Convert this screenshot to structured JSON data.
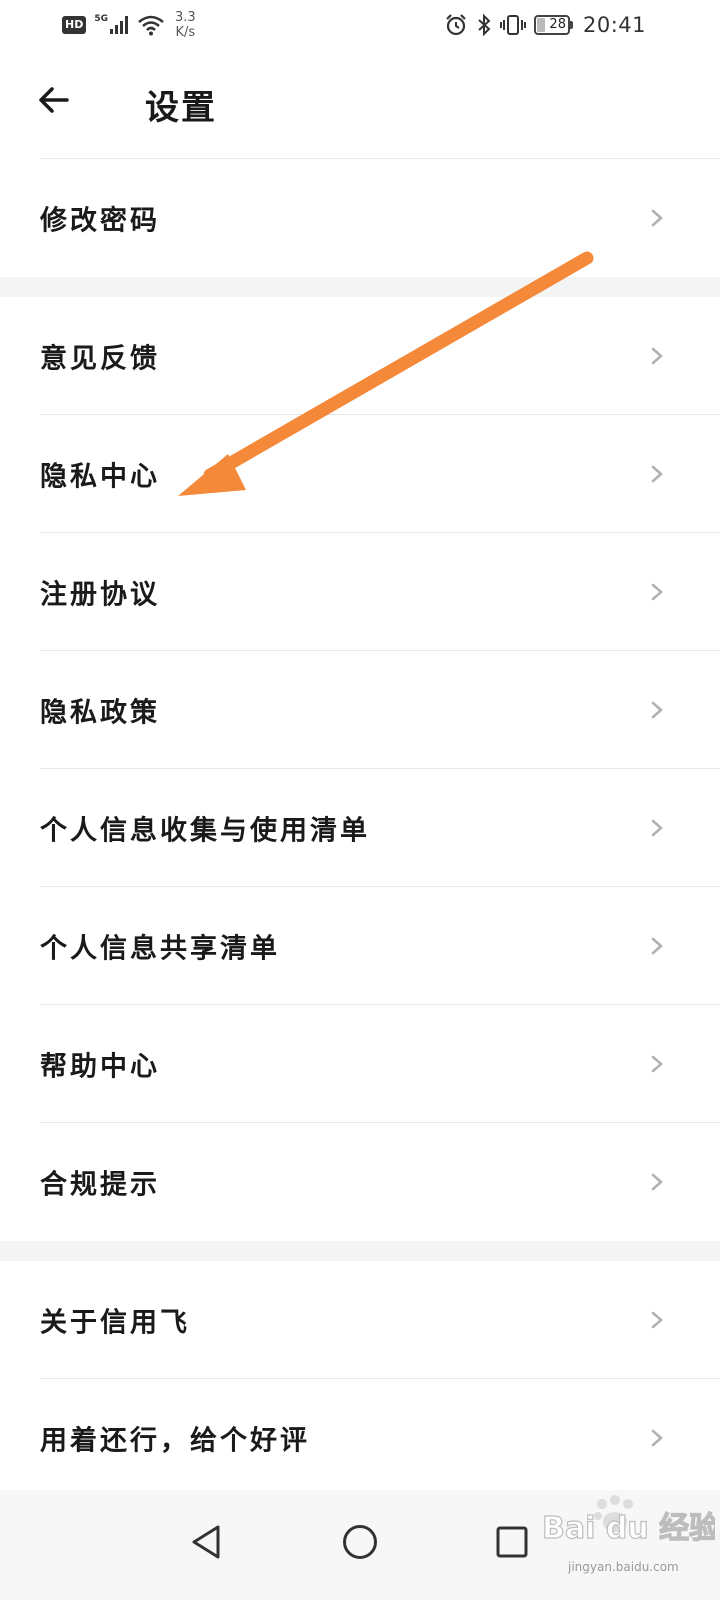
{
  "status_bar": {
    "hd": "HD",
    "network": "5G",
    "speed_value": "3.3",
    "speed_unit": "K/s",
    "battery_level": "28",
    "time": "20:41",
    "icons": [
      "signal-icon",
      "wifi-icon",
      "alarm-icon",
      "bluetooth-icon",
      "vibrate-icon",
      "battery-icon"
    ]
  },
  "header": {
    "title": "设置",
    "back_icon": "arrow-left-icon"
  },
  "menu": {
    "group1": [
      {
        "label": "修改密码"
      }
    ],
    "group2": [
      {
        "label": "意见反馈"
      },
      {
        "label": "隐私中心"
      },
      {
        "label": "注册协议"
      },
      {
        "label": "隐私政策"
      },
      {
        "label": "个人信息收集与使用清单"
      },
      {
        "label": "个人信息共享清单"
      },
      {
        "label": "帮助中心"
      },
      {
        "label": "合规提示"
      }
    ],
    "group3": [
      {
        "label": "关于信用飞"
      },
      {
        "label": "用着还行，给个好评"
      }
    ]
  },
  "annotation": {
    "color": "#f5893a",
    "target": "隐私中心"
  },
  "nav_bar": {
    "buttons": [
      "back-triangle-icon",
      "home-circle-icon",
      "recents-square-icon"
    ]
  },
  "watermark": {
    "text": "Bai du 经验",
    "subtext": "jingyan.baidu.com"
  },
  "colors": {
    "background": "#ffffff",
    "separator": "#f4f4f4",
    "divider": "#e8e8e8",
    "chevron": "#b0b0b0",
    "text": "#1a1a1a"
  }
}
